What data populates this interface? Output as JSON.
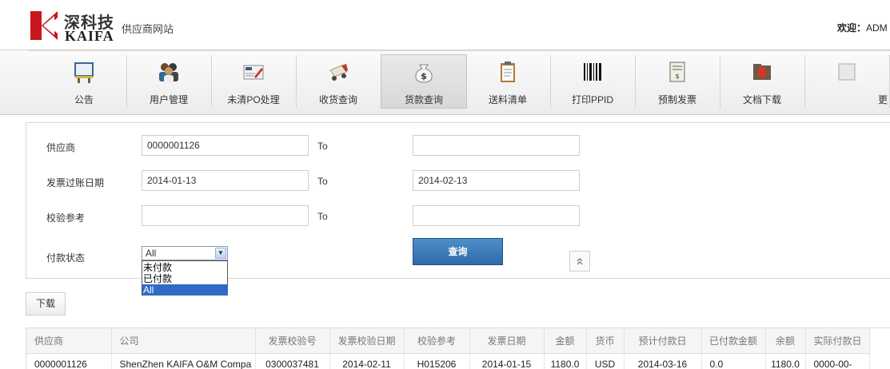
{
  "header": {
    "logo_cn": "深科技",
    "logo_en": "KAIFA",
    "site_name": "供应商网站",
    "welcome_label": "欢迎：",
    "welcome_user": "ADM"
  },
  "toolbar": {
    "items": [
      {
        "label": "公告",
        "icon": "notice-board-icon"
      },
      {
        "label": "用户管理",
        "icon": "users-icon"
      },
      {
        "label": "未清PO处理",
        "icon": "po-document-icon"
      },
      {
        "label": "收货查询",
        "icon": "delivery-icon"
      },
      {
        "label": "货款查询",
        "icon": "money-bag-icon",
        "active": true
      },
      {
        "label": "送料清单",
        "icon": "clipboard-icon"
      },
      {
        "label": "打印PPID",
        "icon": "barcode-icon"
      },
      {
        "label": "预制发票",
        "icon": "invoice-icon"
      },
      {
        "label": "文档下载",
        "icon": "folder-download-icon"
      },
      {
        "label": "更",
        "icon": "more-icon"
      }
    ]
  },
  "form": {
    "supplier_label": "供应商",
    "supplier_from": "0000001126",
    "supplier_to": "",
    "invoice_date_label": "发票过账日期",
    "invoice_date_from": "2014-01-13",
    "invoice_date_to": "2014-02-13",
    "check_ref_label": "校验参考",
    "check_ref_from": "",
    "check_ref_to": "",
    "to_label": "To",
    "payment_status_label": "付款状态",
    "payment_status_value": "All",
    "payment_status_options": [
      "未付款",
      "已付款",
      "All"
    ],
    "query_button": "查询",
    "collapse_symbol": "≈"
  },
  "download_button": "下载",
  "table": {
    "columns": [
      "供应商",
      "公司",
      "发票校验号",
      "发票校验日期",
      "校验参考",
      "发票日期",
      "金额",
      "货币",
      "预计付款日",
      "已付款金额",
      "余额",
      "实际付款日"
    ],
    "rows": [
      [
        "0000001126",
        "ShenZhen KAIFA O&M Compa",
        "0300037481",
        "2014-02-11",
        "H015206",
        "2014-01-15",
        "1180.0",
        "USD",
        "2014-03-16",
        "0.0",
        "1180.0",
        "0000-00-"
      ]
    ]
  },
  "colors": {
    "accent": "#2e6aaa",
    "selected_option": "#3169c6",
    "logo_red": "#c8161d"
  }
}
